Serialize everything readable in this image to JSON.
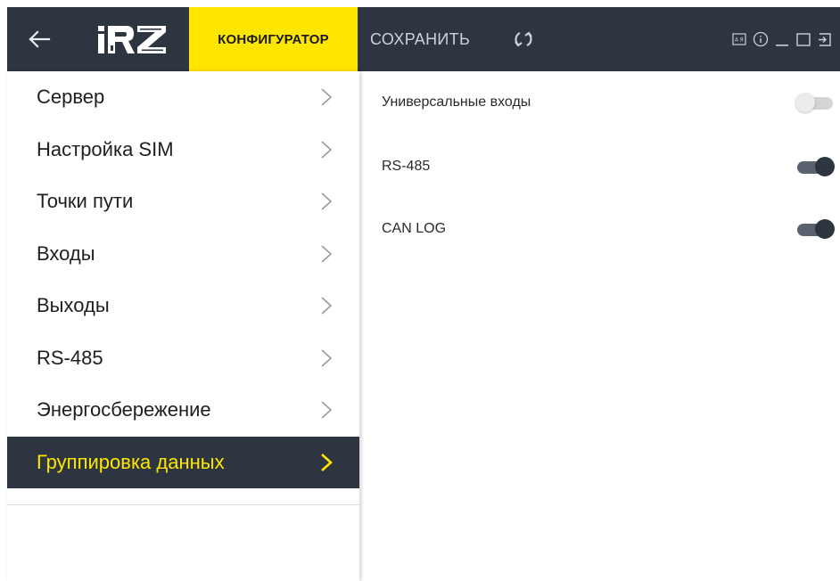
{
  "header": {
    "logo_text": "iRZ",
    "config_tab_label": "КОНФИГУРАТОР",
    "save_label": "СОХРАНИТЬ",
    "icons": [
      "back-arrow-icon",
      "sync-icon",
      "keyboard-layout-icon",
      "info-icon",
      "minimize-icon",
      "maximize-icon",
      "exit-icon"
    ]
  },
  "sidebar": {
    "items": [
      {
        "label": "Сервер",
        "active": false
      },
      {
        "label": "Настройка SIM",
        "active": false
      },
      {
        "label": "Точки пути",
        "active": false
      },
      {
        "label": "Входы",
        "active": false
      },
      {
        "label": "Выходы",
        "active": false
      },
      {
        "label": "RS-485",
        "active": false
      },
      {
        "label": "Энергосбережение",
        "active": false
      },
      {
        "label": "Группировка данных",
        "active": true
      }
    ]
  },
  "main": {
    "toggles": [
      {
        "label": "Универсальные входы",
        "enabled": false
      },
      {
        "label": "RS-485",
        "enabled": true
      },
      {
        "label": "CAN LOG",
        "enabled": true
      }
    ]
  },
  "colors": {
    "header_bg": "#2d3540",
    "accent_yellow": "#ffe600",
    "toggle_on": "#2d3540",
    "toggle_off": "#d4d4d4"
  }
}
